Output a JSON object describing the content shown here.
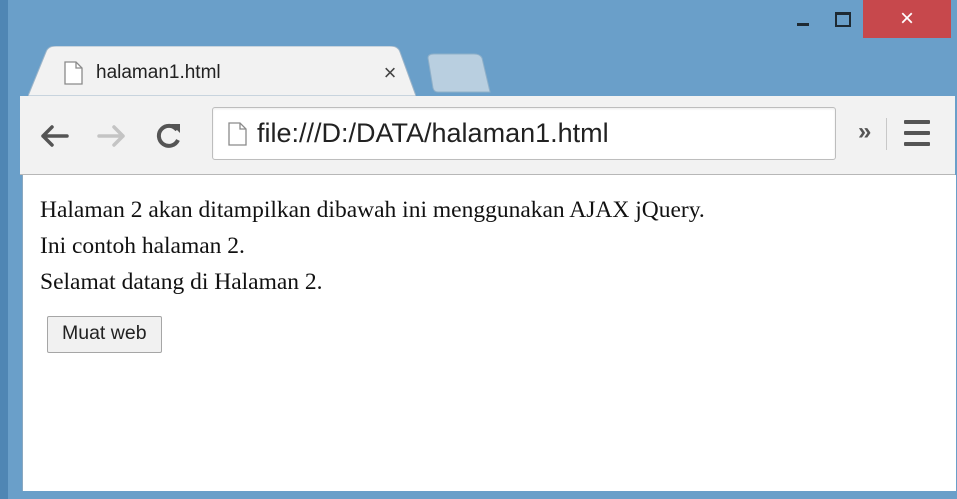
{
  "window": {
    "minimize_icon": "minimize-icon",
    "maximize_icon": "maximize-icon",
    "close_glyph": "×"
  },
  "tab": {
    "title": "halaman1.html",
    "close_glyph": "×",
    "icon": "page-icon"
  },
  "toolbar": {
    "back_icon": "back-arrow-icon",
    "forward_icon": "forward-arrow-icon",
    "reload_icon": "reload-icon",
    "url": "file:///D:/DATA/halaman1.html",
    "overflow_glyph": "»",
    "menu_icon": "hamburger-menu-icon"
  },
  "page": {
    "lines": [
      "Halaman 2 akan ditampilkan dibawah ini menggunakan AJAX jQuery.",
      "Ini contoh halaman 2.",
      "Selamat datang di Halaman 2."
    ],
    "button_label": "Muat web"
  },
  "colors": {
    "frame": "#6a9fc9",
    "close_button": "#c7484c",
    "toolbar": "#f2f2f2",
    "content": "#ffffff"
  }
}
